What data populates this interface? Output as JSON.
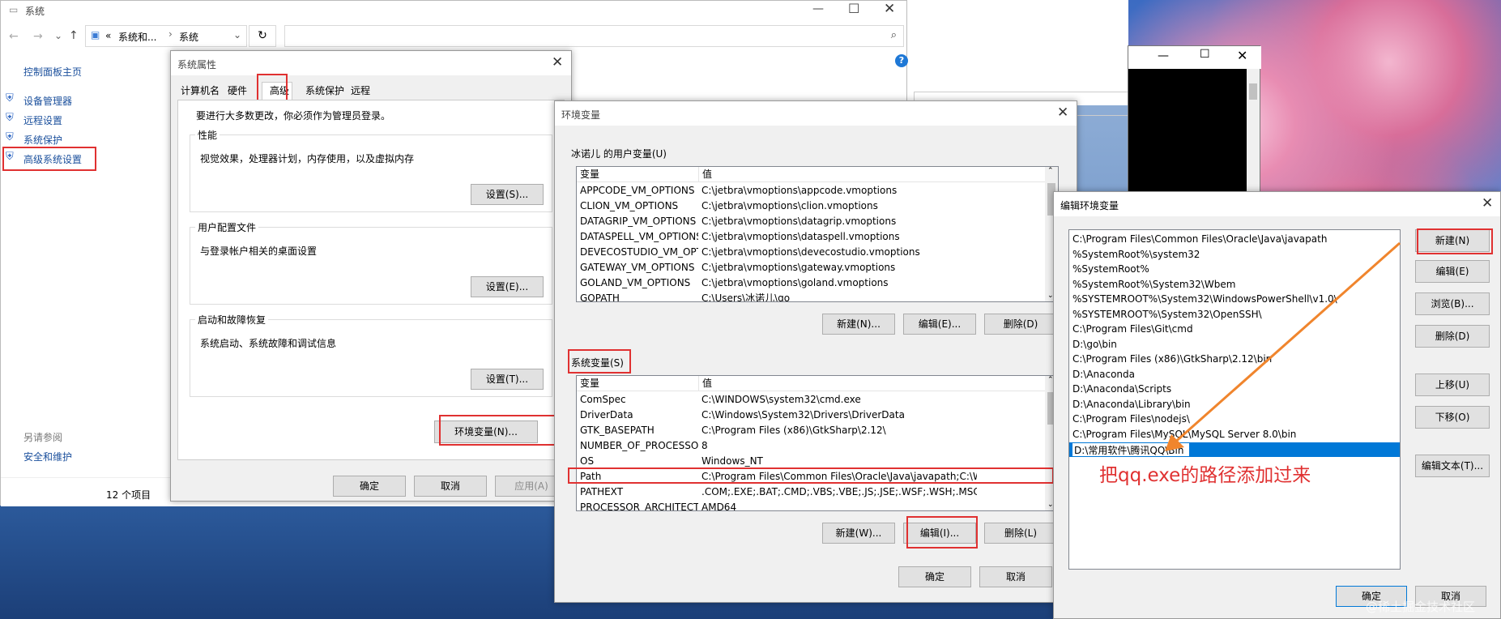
{
  "explorer": {
    "title": "系统",
    "crumb_prefix": "«",
    "crumb_parent": "系统和...",
    "crumb_current": "系统",
    "sidebar_home": "控制面板主页",
    "sidebar_items": [
      "设备管理器",
      "远程设置",
      "系统保护",
      "高级系统设置"
    ],
    "see_also_heading": "另请参阅",
    "see_also_item": "安全和维护",
    "status": "12 个项目",
    "help_glyph": "?"
  },
  "sysprops": {
    "title": "系统属性",
    "tabs": [
      "计算机名",
      "硬件",
      "高级",
      "系统保护",
      "远程"
    ],
    "admin_note": "要进行大多数更改，你必须作为管理员登录。",
    "perf_title": "性能",
    "perf_desc": "视觉效果，处理器计划，内存使用，以及虚拟内存",
    "perf_btn": "设置(S)...",
    "profile_title": "用户配置文件",
    "profile_desc": "与登录帐户相关的桌面设置",
    "profile_btn": "设置(E)...",
    "startup_title": "启动和故障恢复",
    "startup_desc": "系统启动、系统故障和调试信息",
    "startup_btn": "设置(T)...",
    "env_btn": "环境变量(N)...",
    "ok": "确定",
    "cancel": "取消",
    "apply": "应用(A)"
  },
  "envvars": {
    "title": "环境变量",
    "user_label": "冰诺儿 的用户变量(U)",
    "col_var": "变量",
    "col_val": "值",
    "user_rows": [
      [
        "APPCODE_VM_OPTIONS",
        "C:\\jetbra\\vmoptions\\appcode.vmoptions"
      ],
      [
        "CLION_VM_OPTIONS",
        "C:\\jetbra\\vmoptions\\clion.vmoptions"
      ],
      [
        "DATAGRIP_VM_OPTIONS",
        "C:\\jetbra\\vmoptions\\datagrip.vmoptions"
      ],
      [
        "DATASPELL_VM_OPTIONS",
        "C:\\jetbra\\vmoptions\\dataspell.vmoptions"
      ],
      [
        "DEVECOSTUDIO_VM_OPTIO...",
        "C:\\jetbra\\vmoptions\\devecostudio.vmoptions"
      ],
      [
        "GATEWAY_VM_OPTIONS",
        "C:\\jetbra\\vmoptions\\gateway.vmoptions"
      ],
      [
        "GOLAND_VM_OPTIONS",
        "C:\\jetbra\\vmoptions\\goland.vmoptions"
      ],
      [
        "GOPATH",
        "C:\\Users\\冰诺儿\\go"
      ]
    ],
    "user_new": "新建(N)...",
    "user_edit": "编辑(E)...",
    "user_delete": "删除(D)",
    "sys_label": "系统变量(S)",
    "sys_rows": [
      [
        "ComSpec",
        "C:\\WINDOWS\\system32\\cmd.exe"
      ],
      [
        "DriverData",
        "C:\\Windows\\System32\\Drivers\\DriverData"
      ],
      [
        "GTK_BASEPATH",
        "C:\\Program Files (x86)\\GtkSharp\\2.12\\"
      ],
      [
        "NUMBER_OF_PROCESSORS",
        "8"
      ],
      [
        "OS",
        "Windows_NT"
      ],
      [
        "Path",
        "C:\\Program Files\\Common Files\\Oracle\\Java\\javapath;C:\\WINDOW..."
      ],
      [
        "PATHEXT",
        ".COM;.EXE;.BAT;.CMD;.VBS;.VBE;.JS;.JSE;.WSF;.WSH;.MSC;.PY;.PYW"
      ],
      [
        "PROCESSOR_ARCHITECTURE",
        "AMD64"
      ]
    ],
    "sys_new": "新建(W)...",
    "sys_edit": "编辑(I)...",
    "sys_delete": "删除(L)",
    "ok": "确定",
    "cancel": "取消"
  },
  "editenv": {
    "title": "编辑环境变量",
    "paths": [
      "C:\\Program Files\\Common Files\\Oracle\\Java\\javapath",
      "%SystemRoot%\\system32",
      "%SystemRoot%",
      "%SystemRoot%\\System32\\Wbem",
      "%SYSTEMROOT%\\System32\\WindowsPowerShell\\v1.0\\",
      "%SYSTEMROOT%\\System32\\OpenSSH\\",
      "C:\\Program Files\\Git\\cmd",
      "D:\\go\\bin",
      "C:\\Program Files (x86)\\GtkSharp\\2.12\\bin",
      "D:\\Anaconda",
      "D:\\Anaconda\\Scripts",
      "D:\\Anaconda\\Library\\bin",
      "C:\\Program Files\\nodejs\\",
      "C:\\Program Files\\MySQL\\MySQL Server 8.0\\bin"
    ],
    "new_entry": "D:\\常用软件\\腾讯QQ\\Bin",
    "btn_new": "新建(N)",
    "btn_edit": "编辑(E)",
    "btn_browse": "浏览(B)...",
    "btn_delete": "删除(D)",
    "btn_up": "上移(U)",
    "btn_down": "下移(O)",
    "btn_edit_text": "编辑文本(T)...",
    "ok": "确定",
    "cancel": "取消",
    "annotation": "把qq.exe的路径添加过来"
  },
  "watermark": "@稀土掘金技术社区",
  "colors": {
    "highlight_red": "#e03131",
    "arrow_orange": "#f0852d",
    "selection_blue": "#0078d7"
  }
}
